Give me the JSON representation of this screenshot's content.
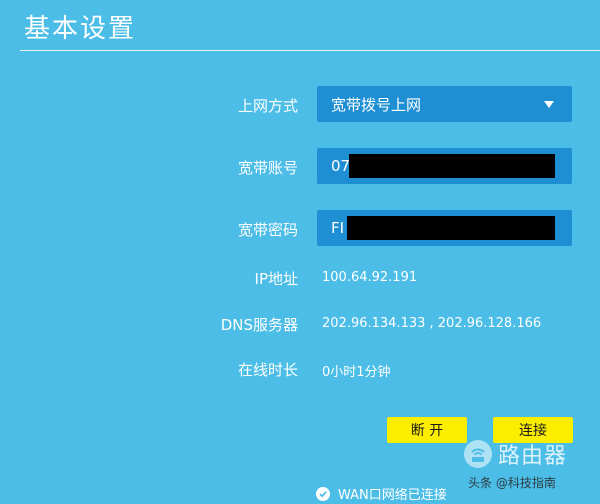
{
  "page": {
    "title": "基本设置"
  },
  "form": {
    "connection_type": {
      "label": "上网方式",
      "value": "宽带拨号上网"
    },
    "account": {
      "label": "宽带账号",
      "value_visible": "07"
    },
    "password": {
      "label": "宽带密码",
      "value_visible": "FI"
    },
    "ip": {
      "label": "IP地址",
      "value": "100.64.92.191"
    },
    "dns": {
      "label": "DNS服务器",
      "value": "202.96.134.133 , 202.96.128.166"
    },
    "uptime": {
      "label": "在线时长",
      "value": "0小时1分钟"
    }
  },
  "buttons": {
    "disconnect": "断 开",
    "connect": "连接"
  },
  "status": {
    "text": "WAN口网络已连接"
  },
  "watermark": {
    "brand": "路由器",
    "credit": "头条 @科技指南"
  },
  "colors": {
    "background": "#4bbde6",
    "field": "#1f8fd4",
    "button": "#fdee00"
  }
}
